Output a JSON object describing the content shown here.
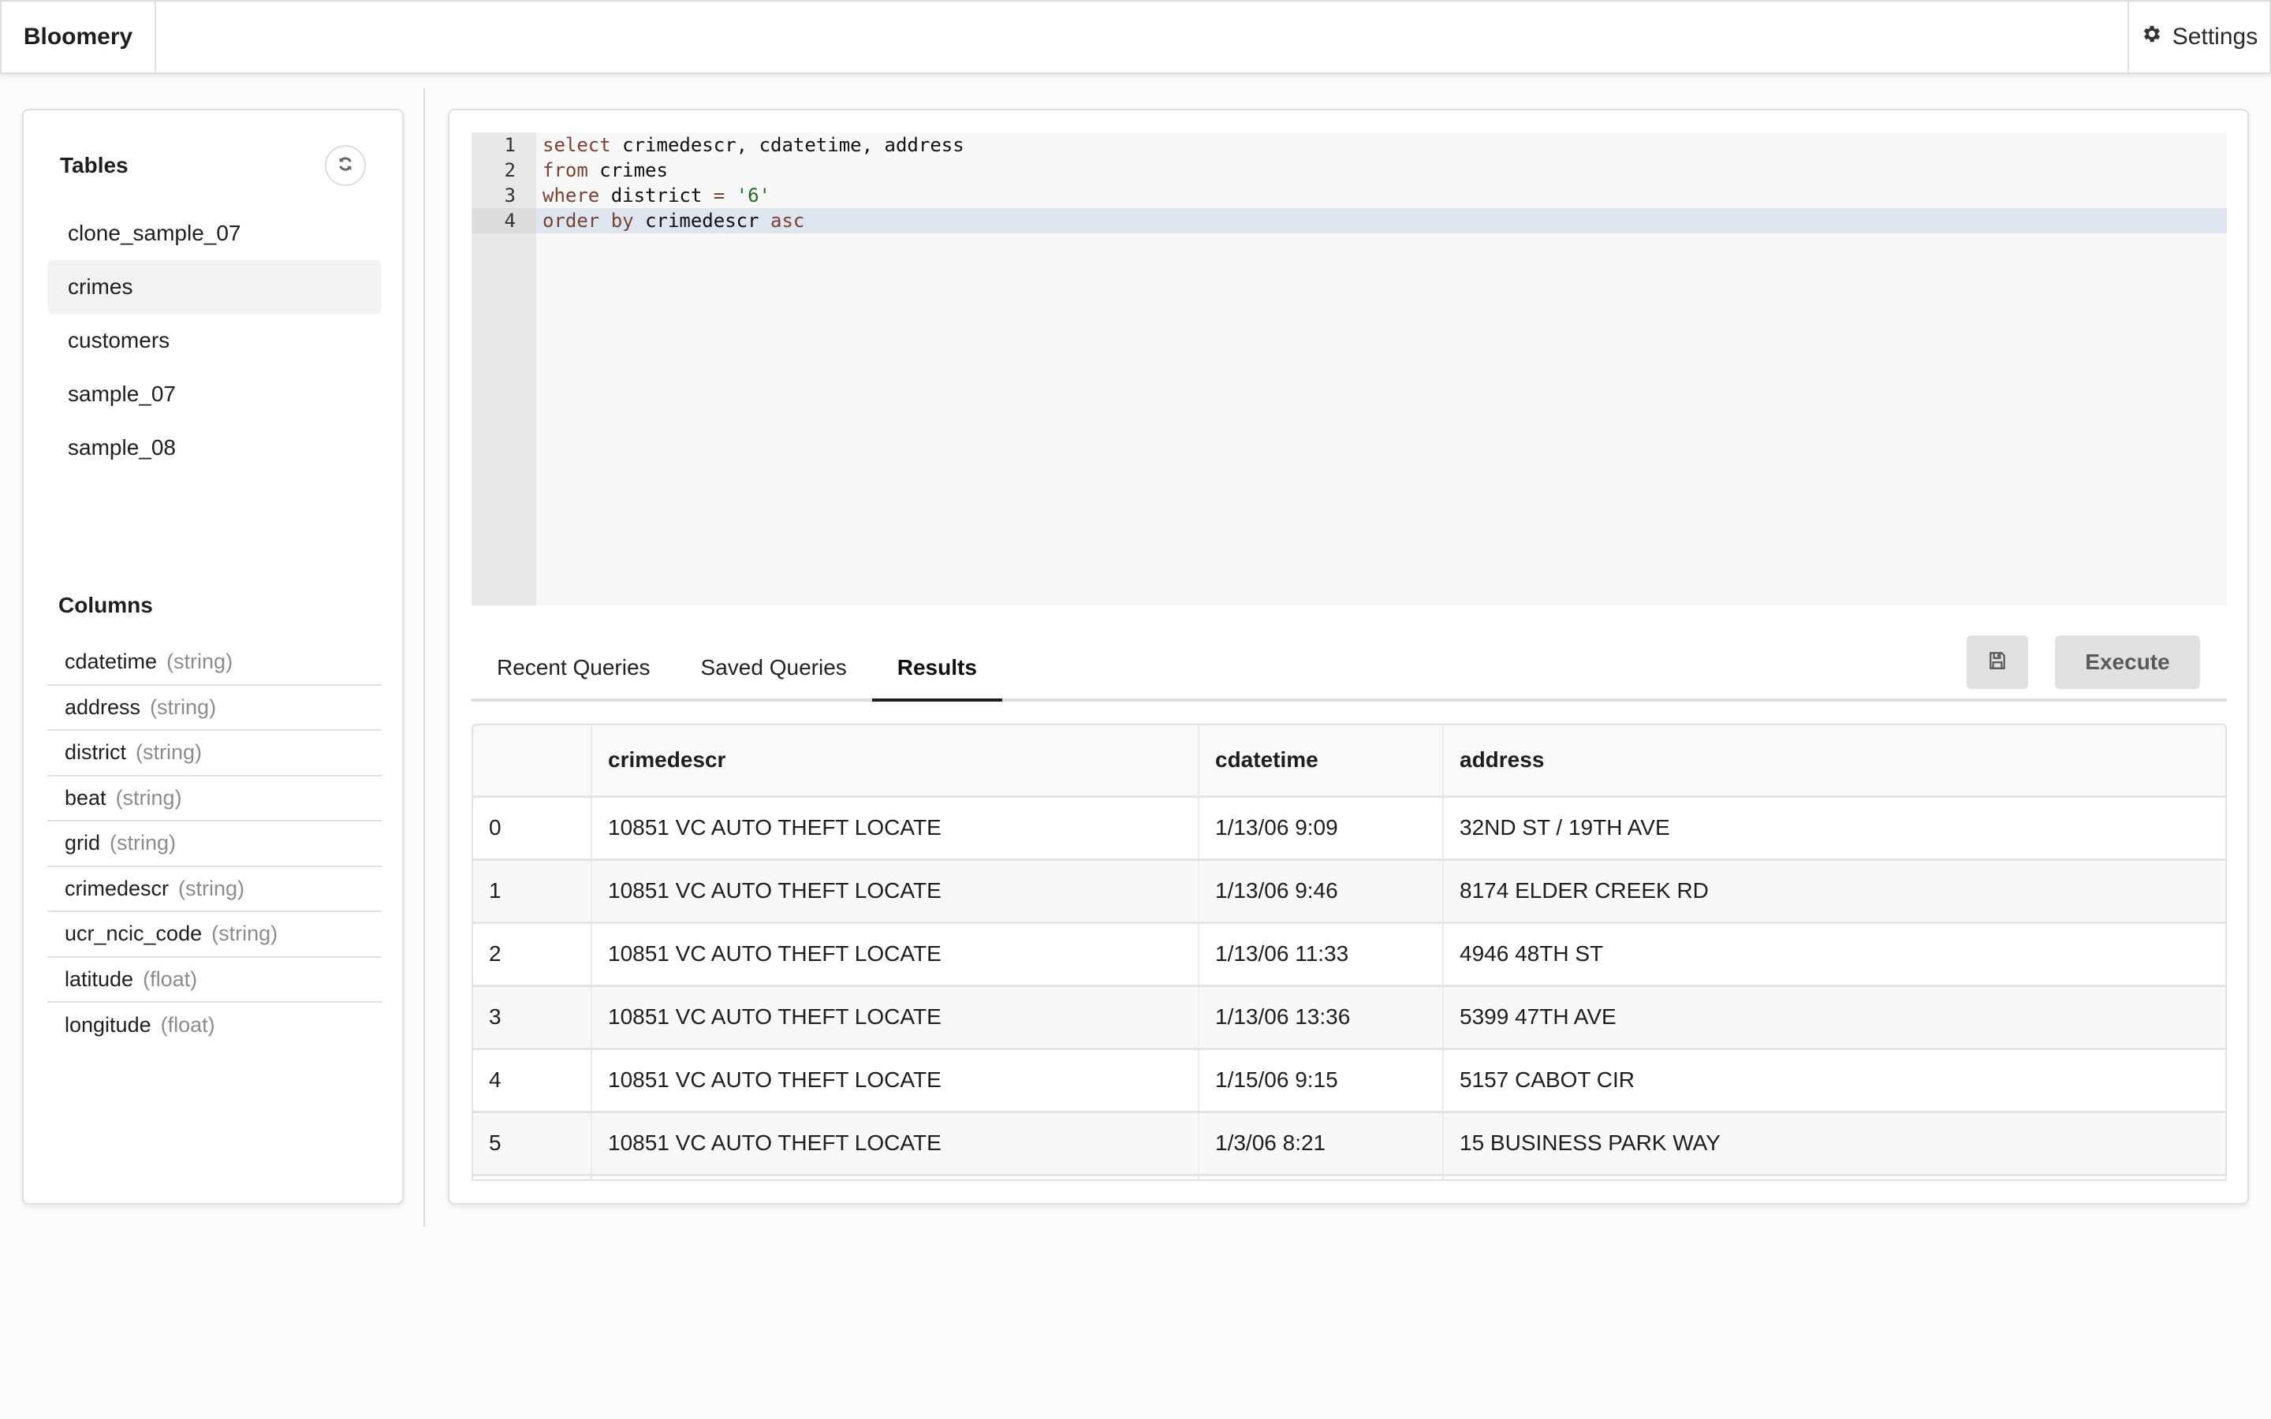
{
  "header": {
    "brand": "Bloomery",
    "settings_label": "Settings",
    "settings_icon": "gear-icon"
  },
  "sidebar": {
    "tables_title": "Tables",
    "refresh_icon": "refresh-icon",
    "tables": [
      {
        "name": "clone_sample_07",
        "active": false
      },
      {
        "name": "crimes",
        "active": true
      },
      {
        "name": "customers",
        "active": false
      },
      {
        "name": "sample_07",
        "active": false
      },
      {
        "name": "sample_08",
        "active": false
      }
    ],
    "columns_title": "Columns",
    "columns": [
      {
        "name": "cdatetime",
        "type": "(string)"
      },
      {
        "name": "address",
        "type": "(string)"
      },
      {
        "name": "district",
        "type": "(string)"
      },
      {
        "name": "beat",
        "type": "(string)"
      },
      {
        "name": "grid",
        "type": "(string)"
      },
      {
        "name": "crimedescr",
        "type": "(string)"
      },
      {
        "name": "ucr_ncic_code",
        "type": "(string)"
      },
      {
        "name": "latitude",
        "type": "(float)"
      },
      {
        "name": "longitude",
        "type": "(float)"
      }
    ]
  },
  "editor": {
    "active_line": 4,
    "lines": [
      {
        "num": "1",
        "text": "select crimedescr, cdatetime, address"
      },
      {
        "num": "2",
        "text": "from crimes"
      },
      {
        "num": "3",
        "text": "where district = '6'"
      },
      {
        "num": "4",
        "text": "order by crimedescr asc"
      }
    ]
  },
  "tabs": [
    {
      "label": "Recent Queries",
      "active": false
    },
    {
      "label": "Saved Queries",
      "active": false
    },
    {
      "label": "Results",
      "active": true
    }
  ],
  "toolbar": {
    "save_icon": "floppy-disk-icon",
    "execute_label": "Execute"
  },
  "results": {
    "columns": [
      "",
      "crimedescr",
      "cdatetime",
      "address"
    ],
    "rows": [
      [
        "0",
        "10851 VC AUTO THEFT LOCATE",
        "1/13/06 9:09",
        "32ND ST / 19TH AVE"
      ],
      [
        "1",
        "10851 VC AUTO THEFT LOCATE",
        "1/13/06 9:46",
        "8174 ELDER CREEK RD"
      ],
      [
        "2",
        "10851 VC AUTO THEFT LOCATE",
        "1/13/06 11:33",
        "4946 48TH ST"
      ],
      [
        "3",
        "10851 VC AUTO THEFT LOCATE",
        "1/13/06 13:36",
        "5399 47TH AVE"
      ],
      [
        "4",
        "10851 VC AUTO THEFT LOCATE",
        "1/15/06 9:15",
        "5157 CABOT CIR"
      ],
      [
        "5",
        "10851 VC AUTO THEFT LOCATE",
        "1/3/06 8:21",
        "15 BUSINESS PARK WAY"
      ]
    ]
  }
}
